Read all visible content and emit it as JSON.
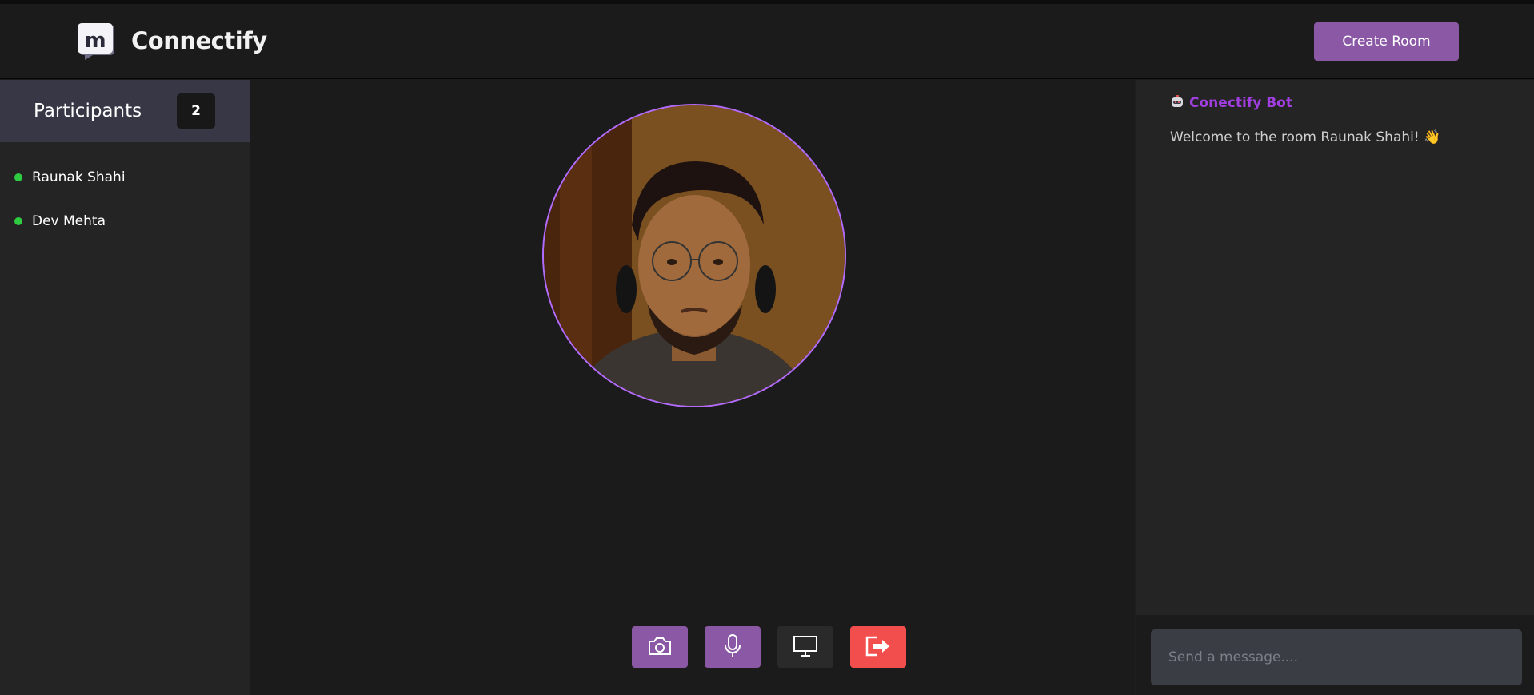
{
  "app": {
    "name": "Connectify"
  },
  "header": {
    "create_room_label": "Create Room"
  },
  "sidebar": {
    "title": "Participants",
    "count": "2",
    "participants": [
      {
        "name": "Raunak Shahi",
        "status": "online"
      },
      {
        "name": "Dev Mehta",
        "status": "online"
      }
    ]
  },
  "video": {
    "ring_color": "#b36bff"
  },
  "controls": [
    {
      "icon": "camera-icon",
      "color": "#8b58a5"
    },
    {
      "icon": "microphone-icon",
      "color": "#8b58a5"
    },
    {
      "icon": "monitor-icon",
      "color": "#2a2a2a"
    },
    {
      "icon": "leave-icon",
      "color": "#f24e4e"
    }
  ],
  "chat": {
    "messages": [
      {
        "author": "Conectify Bot",
        "author_icon": "robot-icon",
        "text": "Welcome to the room Raunak Shahi! 👋"
      }
    ],
    "input_placeholder": "Send a message...."
  },
  "colors": {
    "accent": "#8b58a5",
    "bot_name": "#a03ee0",
    "online": "#2ecc40",
    "danger": "#f24e4e"
  }
}
